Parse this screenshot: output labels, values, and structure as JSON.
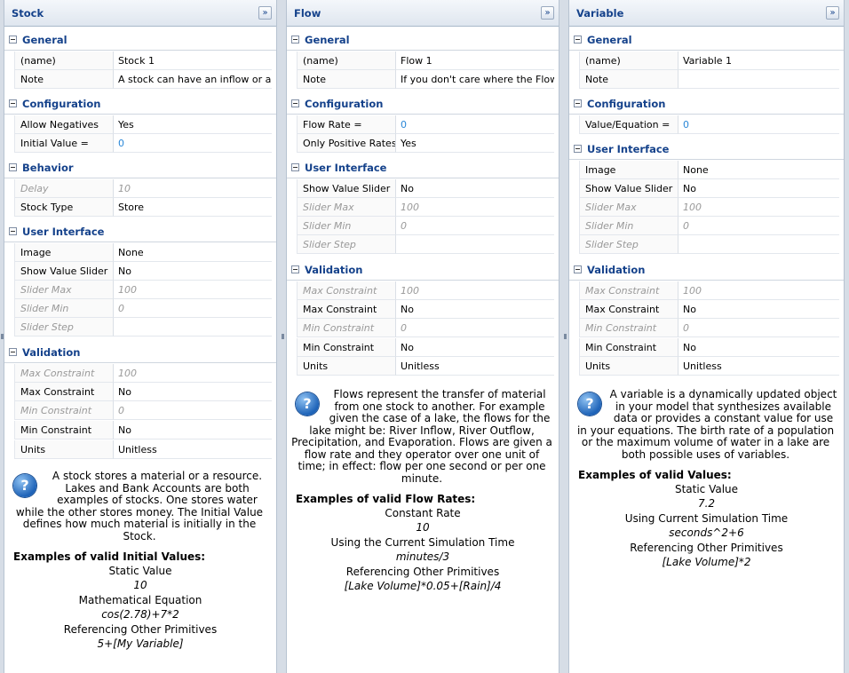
{
  "collapse_glyph": "»",
  "help_glyph": "?",
  "panels": [
    {
      "title": "Stock",
      "groups": [
        {
          "label": "General"
        },
        {
          "label": "Configuration"
        },
        {
          "label": "Behavior"
        },
        {
          "label": "User Interface"
        },
        {
          "label": "Validation"
        }
      ],
      "rows": [
        {
          "name": "(name)",
          "value": "Stock 1"
        },
        {
          "name": "Note",
          "value": "A stock can have an inflow or an ..."
        },
        {
          "name": "Allow Negatives",
          "value": "Yes"
        },
        {
          "name": "Initial Value =",
          "value": "0"
        },
        {
          "name": "Delay",
          "value": "10"
        },
        {
          "name": "Stock Type",
          "value": "Store"
        },
        {
          "name": "Image",
          "value": "None"
        },
        {
          "name": "Show Value Slider",
          "value": "No"
        },
        {
          "name": "Slider Max",
          "value": "100"
        },
        {
          "name": "Slider Min",
          "value": "0"
        },
        {
          "name": "Slider Step",
          "value": ""
        },
        {
          "name": "Max Constraint",
          "value": "100"
        },
        {
          "name": "Max Constraint",
          "value": "No"
        },
        {
          "name": "Min Constraint",
          "value": "0"
        },
        {
          "name": "Min Constraint",
          "value": "No"
        },
        {
          "name": "Units",
          "value": "Unitless"
        }
      ],
      "help": "A stock stores a material or a resource. Lakes and Bank Accounts are both examples of stocks. One stores water while the other stores money. The Initial Value defines how much material is initially in the Stock.",
      "examples_heading": "Examples of valid Initial Values:",
      "examples": [
        {
          "label": "Static Value",
          "value": "10"
        },
        {
          "label": "Mathematical Equation",
          "value": "cos(2.78)+7*2"
        },
        {
          "label": "Referencing Other Primitives",
          "value": "5+[My Variable]"
        }
      ]
    },
    {
      "title": "Flow",
      "groups": [
        {
          "label": "General"
        },
        {
          "label": "Configuration"
        },
        {
          "label": "User Interface"
        },
        {
          "label": "Validation"
        }
      ],
      "rows": [
        {
          "name": "(name)",
          "value": "Flow 1"
        },
        {
          "name": "Note",
          "value": "If you don't care where the Flow ..."
        },
        {
          "name": "Flow Rate =",
          "value": "0"
        },
        {
          "name": "Only Positive Rates",
          "value": "Yes"
        },
        {
          "name": "Show Value Slider",
          "value": "No"
        },
        {
          "name": "Slider Max",
          "value": "100"
        },
        {
          "name": "Slider Min",
          "value": "0"
        },
        {
          "name": "Slider Step",
          "value": ""
        },
        {
          "name": "Max Constraint",
          "value": "100"
        },
        {
          "name": "Max Constraint",
          "value": "No"
        },
        {
          "name": "Min Constraint",
          "value": "0"
        },
        {
          "name": "Min Constraint",
          "value": "No"
        },
        {
          "name": "Units",
          "value": "Unitless"
        }
      ],
      "help": "Flows represent the transfer of material from one stock to another. For example given the case of a lake, the flows for the lake might be: River Inflow, River Outflow, Precipitation, and Evaporation. Flows are given a flow rate and they operator over one unit of time; in effect: flow per one second or per one minute.",
      "examples_heading": "Examples of valid Flow Rates:",
      "examples": [
        {
          "label": "Constant Rate",
          "value": "10"
        },
        {
          "label": "Using the Current Simulation Time",
          "value": "minutes/3"
        },
        {
          "label": "Referencing Other Primitives",
          "value": "[Lake Volume]*0.05+[Rain]/4"
        }
      ]
    },
    {
      "title": "Variable",
      "groups": [
        {
          "label": "General"
        },
        {
          "label": "Configuration"
        },
        {
          "label": "User Interface"
        },
        {
          "label": "Validation"
        }
      ],
      "rows": [
        {
          "name": "(name)",
          "value": "Variable 1"
        },
        {
          "name": "Note",
          "value": ""
        },
        {
          "name": "Value/Equation =",
          "value": "0"
        },
        {
          "name": "Image",
          "value": "None"
        },
        {
          "name": "Show Value Slider",
          "value": "No"
        },
        {
          "name": "Slider Max",
          "value": "100"
        },
        {
          "name": "Slider Min",
          "value": "0"
        },
        {
          "name": "Slider Step",
          "value": ""
        },
        {
          "name": "Max Constraint",
          "value": "100"
        },
        {
          "name": "Max Constraint",
          "value": "No"
        },
        {
          "name": "Min Constraint",
          "value": "0"
        },
        {
          "name": "Min Constraint",
          "value": "No"
        },
        {
          "name": "Units",
          "value": "Unitless"
        }
      ],
      "help": "A variable is a dynamically updated object in your model that synthesizes available data or provides a constant value for use in your equations. The birth rate of a population or the maximum volume of water in a lake are both possible uses of variables.",
      "examples_heading": "Examples of valid Values:",
      "examples": [
        {
          "label": "Static Value",
          "value": "7.2"
        },
        {
          "label": "Using Current Simulation Time",
          "value": "seconds^2+6"
        },
        {
          "label": "Referencing Other Primitives",
          "value": "[Lake Volume]*2"
        }
      ]
    }
  ]
}
